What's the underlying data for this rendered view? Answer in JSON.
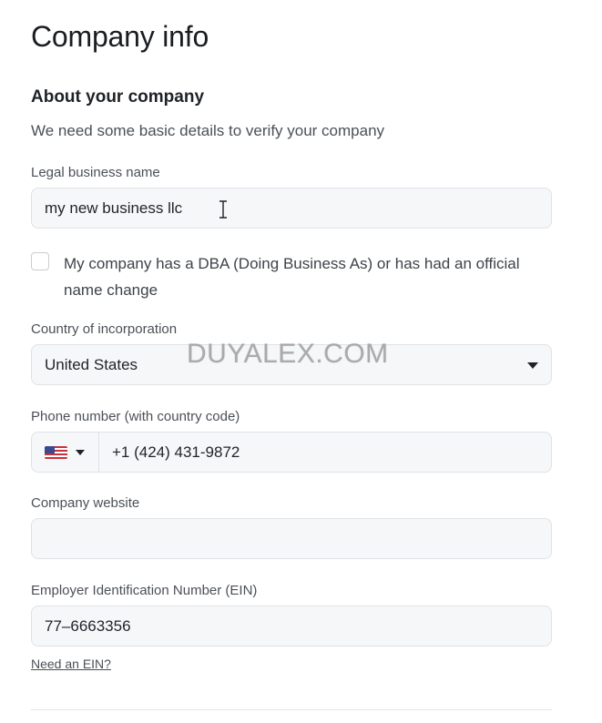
{
  "page": {
    "title": "Company info",
    "section_title": "About your company",
    "section_subtitle": "We need some basic details to verify your company"
  },
  "legal_name": {
    "label": "Legal business name",
    "value": "my new business llc"
  },
  "dba": {
    "checked": false,
    "label": "My company has a DBA (Doing Business As) or has had an official name change"
  },
  "country": {
    "label": "Country of incorporation",
    "selected": "United States"
  },
  "phone": {
    "label": "Phone number (with country code)",
    "country_flag": "us-flag-icon",
    "value": "+1 (424) 431-9872"
  },
  "website": {
    "label": "Company website",
    "value": ""
  },
  "ein": {
    "label": "Employer Identification Number (EIN)",
    "value": "77–6663356",
    "help_link": "Need an EIN?"
  },
  "watermark": "DUYALEX.COM"
}
